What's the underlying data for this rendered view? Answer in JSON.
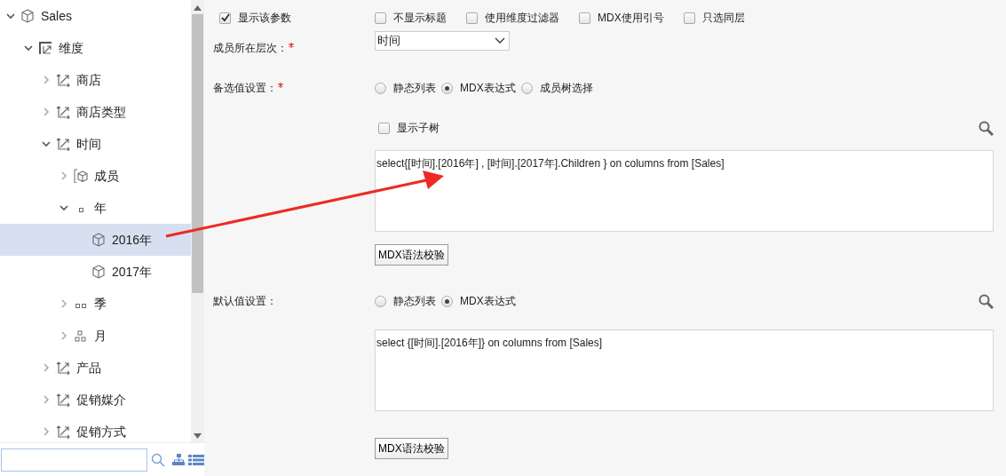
{
  "tree": {
    "nodes": [
      {
        "label": "Sales",
        "kind": "cube",
        "expanded": true,
        "selected": false,
        "children": [
          {
            "label": "维度",
            "kind": "dimension",
            "expanded": true,
            "selected": false,
            "children": [
              {
                "label": "商店",
                "kind": "hierarchy",
                "expanded": false,
                "selected": false
              },
              {
                "label": "商店类型",
                "kind": "hierarchy",
                "expanded": false,
                "selected": false
              },
              {
                "label": "时间",
                "kind": "hierarchy",
                "expanded": true,
                "selected": false,
                "children": [
                  {
                    "label": "成员",
                    "kind": "members",
                    "expanded": false,
                    "selected": false
                  },
                  {
                    "label": "年",
                    "kind": "level1",
                    "expanded": true,
                    "selected": false,
                    "children": [
                      {
                        "label": "2016年",
                        "kind": "member",
                        "selected": true
                      },
                      {
                        "label": "2017年",
                        "kind": "member",
                        "selected": false
                      }
                    ]
                  },
                  {
                    "label": "季",
                    "kind": "level2",
                    "expanded": false,
                    "selected": false
                  },
                  {
                    "label": "月",
                    "kind": "level3",
                    "expanded": false,
                    "selected": false
                  }
                ]
              },
              {
                "label": "产品",
                "kind": "hierarchy",
                "expanded": false,
                "selected": false
              },
              {
                "label": "促销媒介",
                "kind": "hierarchy",
                "expanded": false,
                "selected": false
              },
              {
                "label": "促销方式",
                "kind": "hierarchy",
                "expanded": false,
                "selected": false
              }
            ]
          }
        ]
      }
    ]
  },
  "form": {
    "options": [
      {
        "label": "显示该参数",
        "checked": true
      },
      {
        "label": "不显示标题",
        "checked": false
      },
      {
        "label": "使用维度过滤器",
        "checked": false
      },
      {
        "label": "MDX使用引号",
        "checked": false
      },
      {
        "label": "只选同层",
        "checked": false
      }
    ],
    "level_field": {
      "label": "成员所在层次：",
      "required": true,
      "value": "时间"
    },
    "candidate": {
      "label": "备选值设置：",
      "required": true,
      "modes": [
        {
          "label": "静态列表",
          "selected": false
        },
        {
          "label": "MDX表达式",
          "selected": true
        },
        {
          "label": "成员树选择",
          "selected": false
        }
      ],
      "show_subtree": {
        "label": "显示子树",
        "checked": false
      },
      "expression": "select{[时间].[2016年] , [时间].[2017年].Children } on columns from [Sales]",
      "validate_button": "MDX语法校验"
    },
    "default": {
      "label": "默认值设置：",
      "required": false,
      "modes": [
        {
          "label": "静态列表",
          "selected": false
        },
        {
          "label": "MDX表达式",
          "selected": true
        }
      ],
      "expression": "select {[时间].[2016年]} on columns from [Sales]",
      "validate_button": "MDX语法校验"
    }
  }
}
